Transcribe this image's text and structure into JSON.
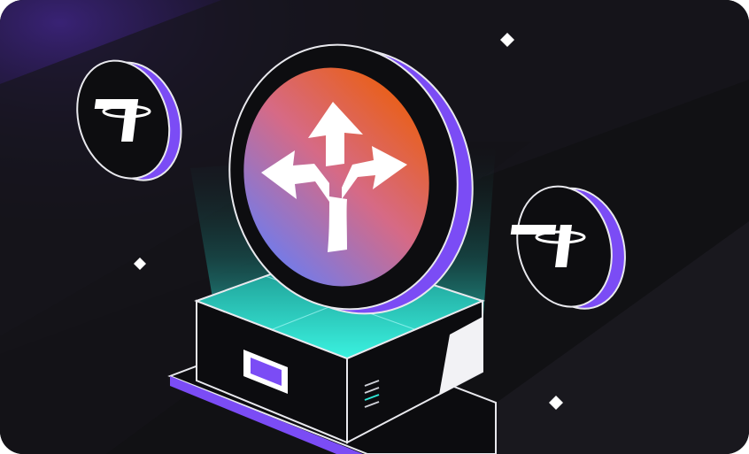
{
  "illustration": {
    "icon": "split-arrows-icon",
    "coin_icon": "tether-icon",
    "colors": {
      "background": "#111114",
      "band_light": "#1b1a20",
      "purple_glow": "#2a1a55",
      "coin_fill": "#0d0d10",
      "coin_edge": "#e9e9ee",
      "accent_purple": "#7b4cf5",
      "gradient_start": "#e0672a",
      "gradient_mid": "#d86a9a",
      "gradient_end": "#6f78e8",
      "beam": "#2fe6d6",
      "pedestal": "#0c0c0f"
    }
  }
}
